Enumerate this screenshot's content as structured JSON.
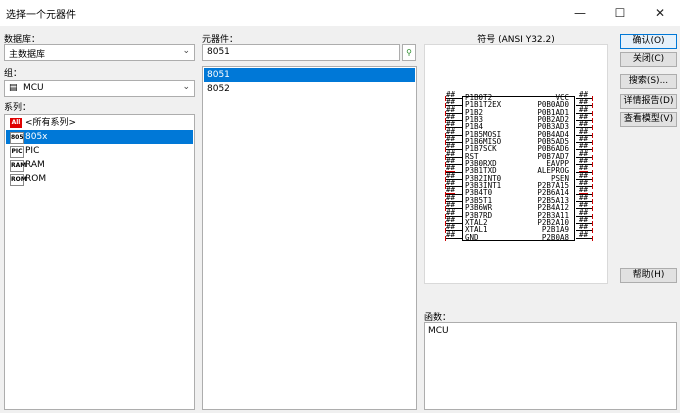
{
  "window": {
    "title": "选择一个元器件",
    "minimize": "—",
    "maximize": "☐",
    "close": "✕"
  },
  "left": {
    "library_label": "数据库：",
    "library_value": "主数据库",
    "group_label": "组：",
    "group_value": "MCU",
    "family_label": "系列：",
    "families": [
      {
        "icon": "All",
        "label": "<所有系列>"
      },
      {
        "icon": "805",
        "label": "805x"
      },
      {
        "icon": "PIC",
        "label": "PIC"
      },
      {
        "icon": "RAM",
        "label": "RAM"
      },
      {
        "icon": "ROM",
        "label": "ROM"
      }
    ]
  },
  "middle": {
    "component_label": "元器件：",
    "search_value": "8051",
    "components": [
      "8051",
      "8052"
    ]
  },
  "symbol": {
    "label": "符号 (ANSI Y32.2)",
    "left_pins": [
      "P1B0T2",
      "P1B1T2EX",
      "P1B2",
      "P1B3",
      "P1B4",
      "P1B5MOSI",
      "P1B6MISO",
      "P1B7SCK",
      "RST",
      "P3B0RXD",
      "P3B1TXD",
      "P3B2INT0",
      "P3B3INT1",
      "P3B4T0",
      "P3B5T1",
      "P3B6WR",
      "P3B7RD",
      "XTAL2",
      "XTAL1",
      "GND"
    ],
    "right_pins": [
      "VCC",
      "P0B0AD0",
      "P0B1AD1",
      "P0B2AD2",
      "P0B3AD3",
      "P0B4AD4",
      "P0B5AD5",
      "P0B6AD6",
      "P0B7AD7",
      "EAVPP",
      "ALEPROG",
      "PSEN",
      "P2B7A15",
      "P2B6A14",
      "P2B5A13",
      "P2B4A12",
      "P2B3A11",
      "P2B2A10",
      "P2B1A9",
      "P2B0A8"
    ],
    "pin_num": "##"
  },
  "function": {
    "label": "函数：",
    "value": "MCU"
  },
  "buttons": {
    "ok": "确认(O)",
    "close": "关闭(C)",
    "search": "搜索(S)...",
    "detail": "详情报告(D)",
    "model": "查看模型(V)",
    "help": "帮助(H)"
  },
  "colors": {
    "selection": "#0078d7",
    "pin_red": "#cc0000",
    "all_icon": "#e00000"
  }
}
